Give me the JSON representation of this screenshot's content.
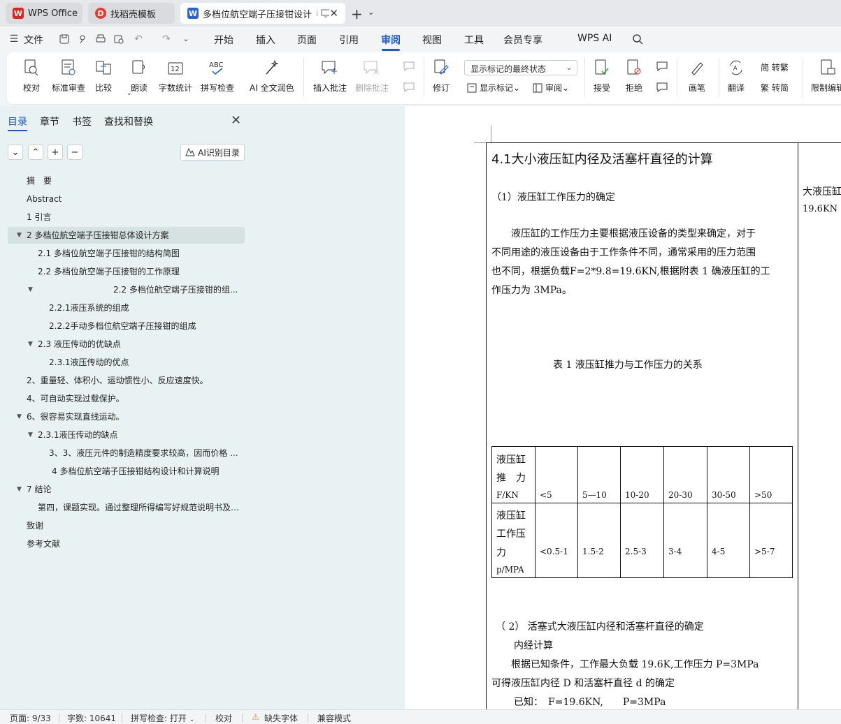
{
  "tabs": [
    {
      "label": "WPS Office",
      "icon": "wps-logo-icon"
    },
    {
      "label": "找稻壳模板",
      "icon": "docer-logo-icon"
    },
    {
      "label": "多档位航空端子压接钳设计",
      "icon": "word-doc-icon",
      "suffix": "i"
    }
  ],
  "menu": {
    "file": "文件",
    "items": [
      "开始",
      "插入",
      "页面",
      "引用",
      "审阅",
      "视图",
      "工具",
      "会员专享",
      "WPS AI"
    ],
    "active": "审阅"
  },
  "ribbon": {
    "proofread": "校对",
    "standard_review": "标准审查",
    "compare": "比较",
    "read_aloud": "朗读",
    "word_count": "字数统计",
    "spell_check": "拼写检查",
    "ai_polish": "AI 全文润色",
    "insert_comment": "插入批注",
    "delete_comment": "删除批注",
    "track_changes": "修订",
    "display_markup_select": "显示标记的最终状态",
    "show_markup": "显示标记",
    "review_pane": "审阅",
    "accept": "接受",
    "reject": "拒绝",
    "pen": "画笔",
    "translate": "翻译",
    "to_traditional": "简 转繁",
    "to_simplified": "繁 转简",
    "restrict_edit": "限制编辑"
  },
  "left_panel": {
    "tabs": [
      "目录",
      "章节",
      "书签",
      "查找和替换"
    ],
    "active_tab": "目录",
    "ai_button": "AI识别目录",
    "toc": [
      {
        "label": "摘　要",
        "level": 1,
        "arrow": false
      },
      {
        "label": "Abstract",
        "level": 1,
        "arrow": false
      },
      {
        "label": "1  引言",
        "level": 1,
        "arrow": false
      },
      {
        "label": "2 多档位航空端子压接钳总体设计方案",
        "level": 1,
        "arrow": true,
        "selected": true
      },
      {
        "label": "2.1 多档位航空端子压接钳的结构简图",
        "level": 2,
        "arrow": false
      },
      {
        "label": "2.2 多档位航空端子压接钳的工作原理",
        "level": 2,
        "arrow": false
      },
      {
        "label": "2.2 多档位航空端子压接钳的组...",
        "level": 2,
        "arrow": true,
        "indent_wide": true
      },
      {
        "label": "2.2.1液压系统的组成",
        "level": 3,
        "arrow": false
      },
      {
        "label": "2.2.2手动多档位航空端子压接钳的组成",
        "level": 3,
        "arrow": false
      },
      {
        "label": "2.3 液压传动的优缺点",
        "level": 2,
        "arrow": true
      },
      {
        "label": "2.3.1液压传动的优点",
        "level": 3,
        "arrow": false
      },
      {
        "label": "2、重量轻、体积小、运动惯性小、反应速度快。",
        "level": 1,
        "arrow": false
      },
      {
        "label": "4、可自动实现过载保护。",
        "level": 1,
        "arrow": false
      },
      {
        "label": "6、很容易实现直线运动。",
        "level": 1,
        "arrow": true
      },
      {
        "label": "2.3.1液压传动的缺点",
        "level": 2,
        "arrow": true
      },
      {
        "label": "3、3、液压元件的制造精度要求较高，因而价格 ...",
        "level": 3,
        "arrow": false
      },
      {
        "label": "4 多档位航空端子压接钳结构设计和计算说明",
        "level": 3,
        "arrow": false
      },
      {
        "label": "7  结论",
        "level": 1,
        "arrow": true
      },
      {
        "label": "第四，课题实现。通过整理所得编写好规范说明书及 ...",
        "level": 2,
        "arrow": false
      },
      {
        "label": "致谢",
        "level": 1,
        "arrow": false
      },
      {
        "label": "参考文献",
        "level": 1,
        "arrow": false
      }
    ]
  },
  "document": {
    "heading": "4.1大小液压缸内径及活塞杆直径的计算",
    "sub1": "（1）液压缸工作压力的确定",
    "para1": [
      "　　液压缸的工作压力主要根据液压设备的类型来确定，对于",
      "不同用途的液压设备由于工作条件不同，通常采用的压力范围",
      "也不同，根据负载F=2*9.8=19.6KN,根据附表 1 确液压缸的工",
      "作压力为 3MPa。"
    ],
    "table_caption": "表 1 液压缸推力与工作压力的关系",
    "table": {
      "row1_header": [
        "液压缸",
        "推　力",
        "F/KN"
      ],
      "row1": [
        "<5",
        "5—10",
        "10-20",
        "20-30",
        "30-50",
        ">50"
      ],
      "row2_header": [
        "液压缸",
        "工作压",
        "力",
        "p/MPA"
      ],
      "row2": [
        "<0.5-1",
        "1.5-2",
        "2.5-3",
        "3-4",
        "4-5",
        ">5-7"
      ]
    },
    "sub2": "（ 2）  活塞式大液压缸内径和活塞杆直径的确定",
    "sub2b": "内经计算",
    "para2": [
      "　　根据已知条件，工作最大负载 19.6K,工作压力 P=3MPa",
      "可得液压缸内径 D 和活塞杆直径 d 的确定"
    ],
    "known": "已知：　F=19.6KN,　　P=3MPa",
    "right_col": [
      "大液压缸",
      "19.6KN"
    ]
  },
  "status": {
    "page": "页面: 9/33",
    "words": "字数: 10641",
    "spell": "拼写检查: 打开",
    "proof": "校对",
    "missing_font": "缺失字体",
    "compat": "兼容模式"
  },
  "colors": {
    "accent": "#1a56d6",
    "wps_red": "#e2231a",
    "word_blue": "#2b62d9"
  }
}
